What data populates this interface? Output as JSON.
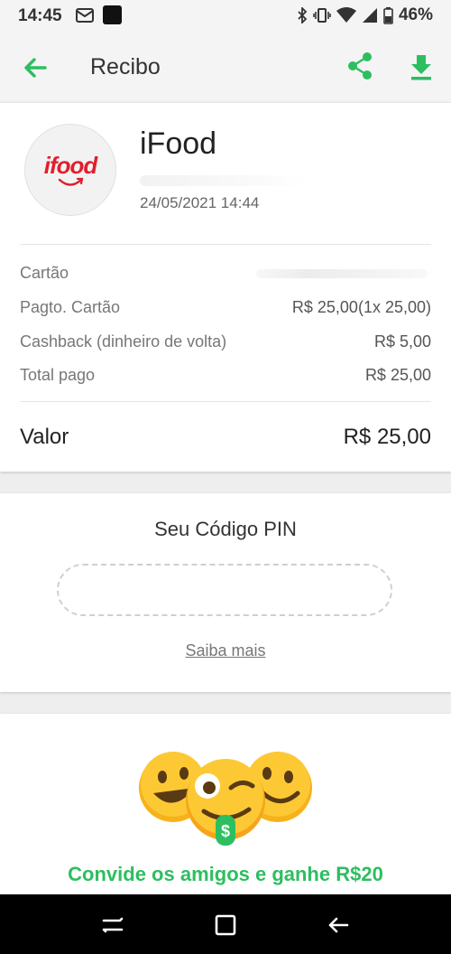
{
  "status_bar": {
    "time": "14:45",
    "battery": "46%",
    "icons": [
      "mail-icon",
      "app-icon",
      "bluetooth-icon",
      "vibrate-icon",
      "wifi-icon",
      "signal-icon",
      "battery-icon"
    ]
  },
  "app_bar": {
    "title": "Recibo",
    "back_icon": "back-arrow-icon",
    "share_icon": "share-icon",
    "download_icon": "download-icon",
    "accent_color": "#2dbe60"
  },
  "receipt": {
    "logo_text": "ifood",
    "logo_color": "#e01f2d",
    "merchant": "iFood",
    "datetime": "24/05/2021 14:44",
    "rows": [
      {
        "label": "Cartão",
        "value": ""
      },
      {
        "label": "Pagto. Cartão",
        "value": "R$ 25,00(1x 25,00)"
      },
      {
        "label": "Cashback (dinheiro de volta)",
        "value": "R$ 5,00"
      },
      {
        "label": "Total pago",
        "value": "R$ 25,00"
      }
    ],
    "total_label": "Valor",
    "total_value": "R$ 25,00"
  },
  "pin": {
    "title": "Seu Código PIN",
    "learn_more": "Saiba mais"
  },
  "invite": {
    "text": "Convide os amigos e ganhe R$20",
    "emoji_badge": "$"
  },
  "nav_bar": {
    "icons": [
      "recents-icon",
      "home-icon",
      "back-icon"
    ]
  }
}
